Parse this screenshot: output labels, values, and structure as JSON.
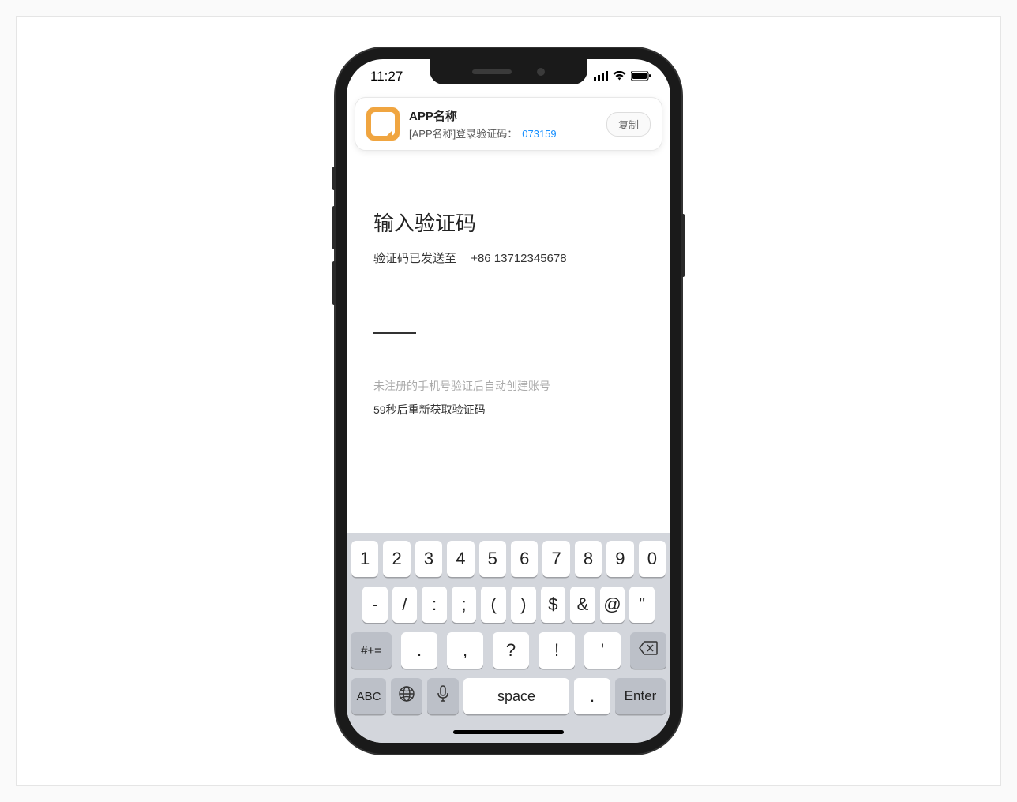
{
  "status_bar": {
    "time": "11:27"
  },
  "notification": {
    "app_name": "APP名称",
    "message_prefix": "[APP名称]登录验证码：",
    "code": "073159",
    "copy_label": "复制"
  },
  "content": {
    "title": "输入验证码",
    "sent_label": "验证码已发送至",
    "phone": "+86 13712345678",
    "hint": "未注册的手机号验证后自动创建账号",
    "resend": "59秒后重新获取验证码"
  },
  "keyboard": {
    "row1": [
      "1",
      "2",
      "3",
      "4",
      "5",
      "6",
      "7",
      "8",
      "9",
      "0"
    ],
    "row2": [
      "-",
      "/",
      ":",
      ";",
      "(",
      ")",
      "$",
      "&",
      "@",
      "\""
    ],
    "shift": "#+=",
    "row3": [
      ".",
      ",",
      "?",
      "!",
      "'"
    ],
    "abc": "ABC",
    "space": "space",
    "dot": ".",
    "enter": "Enter"
  }
}
